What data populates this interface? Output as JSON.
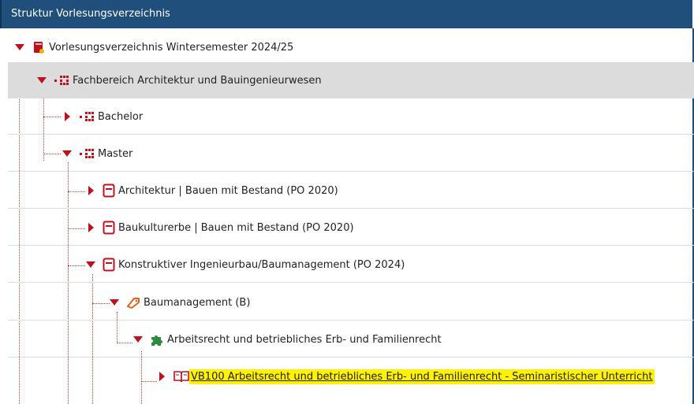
{
  "header": {
    "title": "Struktur Vorlesungsverzeichnis"
  },
  "tree": {
    "root": "Vorlesungsverzeichnis Wintersemester 2024/25",
    "faculty": "Fachbereich Architektur und Bauingenieurwesen",
    "bachelor": "Bachelor",
    "master": "Master",
    "prog1": "Architektur | Bauen mit Bestand (PO 2020)",
    "prog2": "Baukulturerbe | Bauen mit Bestand (PO 2020)",
    "prog3": "Konstruktiver Ingenieurbau/Baumanagement (PO 2024)",
    "module": "Baumanagement (B)",
    "submodule": "Arbeitsrecht und betriebliches Erb- und Familienrecht",
    "course": "VB100 Arbeitsrecht und betriebliches Erb- und Familienrecht - Seminaristischer Unterricht"
  },
  "colors": {
    "header_bg": "#1f4f7a",
    "accent_red": "#c0101c",
    "highlight": "#fff200"
  },
  "icons": {
    "expanded": "caret-down-icon",
    "collapsed": "caret-right-icon"
  }
}
